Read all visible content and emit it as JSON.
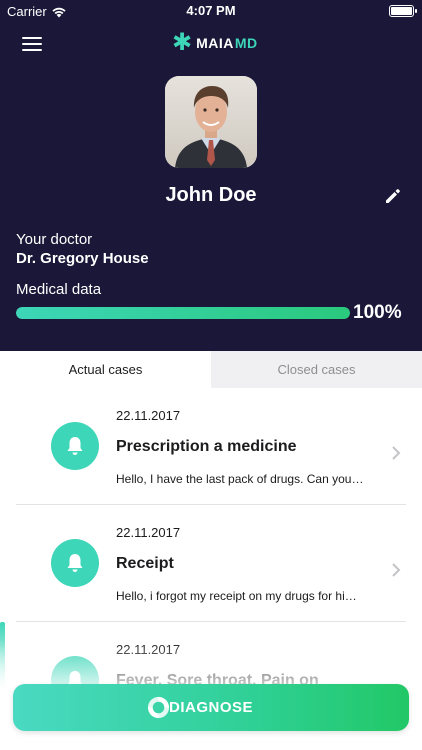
{
  "status_bar": {
    "carrier": "Carrier",
    "time": "4:07 PM"
  },
  "app": {
    "logo_part1": "MAIA",
    "logo_part2": "MD",
    "accent_color": "#3dd6b8",
    "header_bg": "#1b1738"
  },
  "profile": {
    "name": "John Doe",
    "doctor_label": "Your doctor",
    "doctor_name": "Dr. Gregory House",
    "medical_label": "Medical data",
    "medical_progress": 100,
    "medical_progress_text": "100%"
  },
  "tabs": [
    {
      "label": "Actual cases",
      "active": true
    },
    {
      "label": "Closed cases",
      "active": false
    }
  ],
  "cases": [
    {
      "date": "22.11.2017",
      "title": "Prescription a medicine",
      "preview": "Hello, I have the last pack of drugs. Can you…",
      "icon": "bell-icon"
    },
    {
      "date": "22.11.2017",
      "title": "Receipt",
      "preview": "Hello, i forgot my receipt on my drugs for hi…",
      "icon": "bell-icon"
    },
    {
      "date": "22.11.2017",
      "title": "Fever, Sore throat, Pain on",
      "preview": "",
      "icon": "bell-icon"
    }
  ],
  "diagnose": {
    "label": "DIAGNOSE",
    "icon": "diagnose-icon"
  }
}
